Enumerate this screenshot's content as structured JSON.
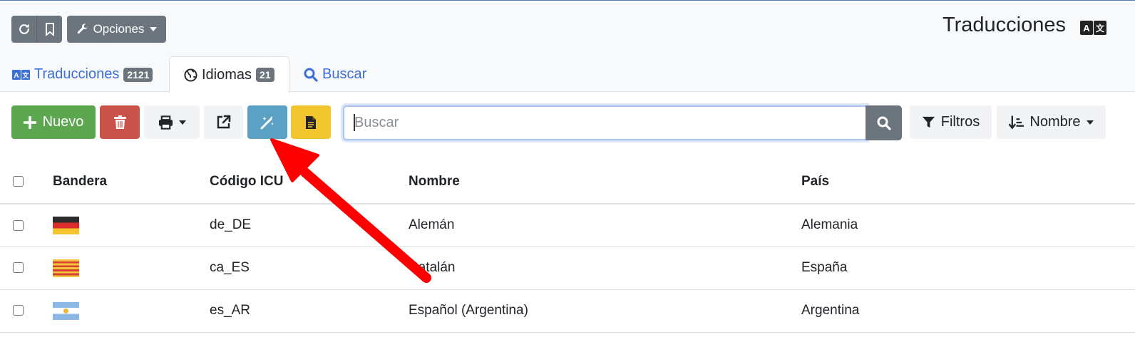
{
  "header": {
    "title": "Traducciones",
    "options_label": "Opciones",
    "title_icon": "language-icon"
  },
  "tabs": [
    {
      "label": "Traducciones",
      "badge": "2121",
      "icon": "language-icon"
    },
    {
      "label": "Idiomas",
      "badge": "21",
      "icon": "globe-icon"
    },
    {
      "label": "Buscar",
      "icon": "search-icon"
    }
  ],
  "toolbar": {
    "new_label": "Nuevo",
    "search_placeholder": "Buscar",
    "filters_label": "Filtros",
    "sort_label": "Nombre"
  },
  "table": {
    "columns": [
      "Bandera",
      "Código ICU",
      "Nombre",
      "País"
    ],
    "rows": [
      {
        "flag": "de",
        "code": "de_DE",
        "name": "Alemán",
        "country": "Alemania"
      },
      {
        "flag": "ca",
        "code": "ca_ES",
        "name": "Catalán",
        "country": "España"
      },
      {
        "flag": "ar",
        "code": "es_AR",
        "name": "Español (Argentina)",
        "country": "Argentina"
      }
    ]
  },
  "colors": {
    "accent_blue": "#3c6fd8",
    "success": "#5ba64f",
    "danger": "#c9524a",
    "info": "#5aa1c3",
    "warning": "#f0c52e",
    "secondary": "#6c757d",
    "annotation_arrow": "#ff0000"
  }
}
